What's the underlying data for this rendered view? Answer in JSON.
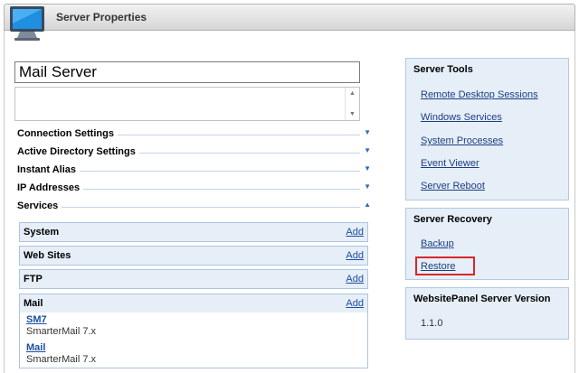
{
  "window": {
    "title": "Server Properties"
  },
  "server_name": {
    "value": "Mail Server"
  },
  "sections": [
    {
      "label": "Connection Settings",
      "state": "collapsed"
    },
    {
      "label": "Active Directory Settings",
      "state": "collapsed"
    },
    {
      "label": "Instant Alias",
      "state": "collapsed"
    },
    {
      "label": "IP Addresses",
      "state": "collapsed"
    },
    {
      "label": "Services",
      "state": "expanded"
    }
  ],
  "services": {
    "groups": [
      {
        "name": "System",
        "add_label": "Add"
      },
      {
        "name": "Web Sites",
        "add_label": "Add"
      },
      {
        "name": "FTP",
        "add_label": "Add"
      },
      {
        "name": "Mail",
        "add_label": "Add"
      }
    ],
    "mail_items": [
      {
        "name": "SM7",
        "provider": "SmarterMail 7.x"
      },
      {
        "name": "Mail",
        "provider": "SmarterMail 7.x"
      }
    ]
  },
  "server_tools": {
    "title": "Server Tools",
    "links": [
      "Remote Desktop Sessions",
      "Windows Services",
      "System Processes",
      "Event Viewer",
      "Server Reboot"
    ]
  },
  "server_recovery": {
    "title": "Server Recovery",
    "links": [
      "Backup",
      "Restore"
    ],
    "highlighted": "Restore",
    "highlight_color": "#d9262c"
  },
  "version": {
    "title": "WebsitePanel Server Version",
    "value": "1.1.0"
  },
  "colors": {
    "accent": "#2b6cc0",
    "link": "#1a4fa0",
    "panel_bg": "#e6eef8"
  },
  "icons": {
    "window": "monitor-icon",
    "collapsed": "chevron-down-icon",
    "expanded": "chevron-up-icon"
  }
}
